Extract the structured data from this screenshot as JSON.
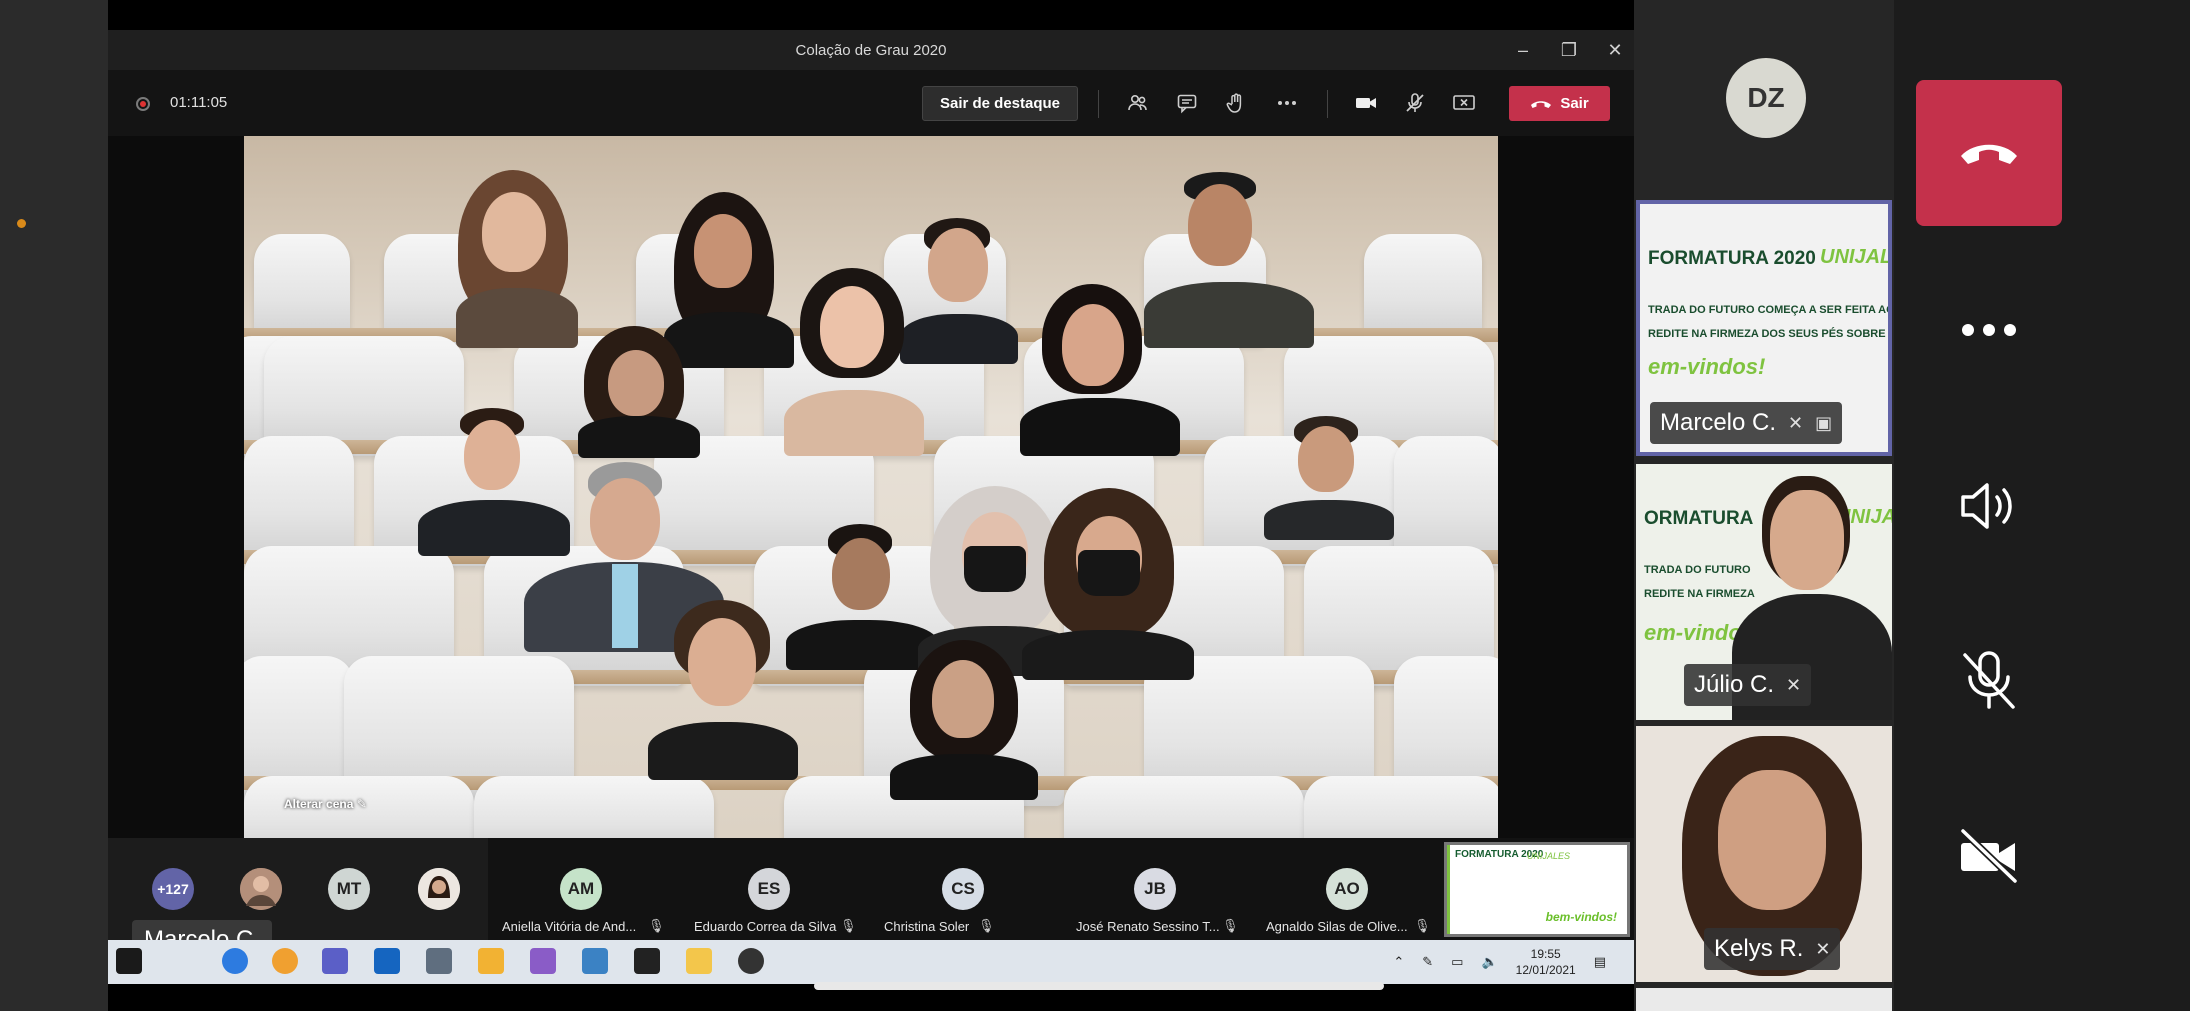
{
  "window": {
    "title": "Colação de Grau 2020",
    "controls": [
      "–",
      "❐",
      "✕"
    ]
  },
  "toolbar": {
    "recording_time": "01:11:05",
    "spotlight_label": "Sair de destaque",
    "leave_label": "Sair"
  },
  "stage": {
    "scene_label": "Alterar cena ✎"
  },
  "strip": {
    "overflow": "+127",
    "avatars": [
      {
        "initials": "MT",
        "color": "#cfd6d3"
      },
      {
        "initials": "AM",
        "color": "#c5e3c9"
      },
      {
        "initials": "ES",
        "color": "#d4d6da"
      },
      {
        "initials": "CS",
        "color": "#d6dde6"
      },
      {
        "initials": "JB",
        "color": "#d9dbe3"
      },
      {
        "initials": "AO",
        "color": "#d5e1d8"
      }
    ],
    "names": [
      "Aniella Vitória de And...",
      "Eduardo Correa da Silva",
      "Christina Soler",
      "José Renato Sessino T...",
      "Agnaldo Silas de Olive..."
    ],
    "mini_slide": {
      "title": "FORMATURA 2020",
      "brand": "UNIJALES",
      "greeting": "bem-vindos!"
    }
  },
  "overlay_name": "Marcelo C.",
  "taskbar": {
    "time": "19:55",
    "date": "12/01/2021"
  },
  "right_panel": {
    "me_initials": "DZ",
    "tiles": [
      {
        "name": "Marcelo C.",
        "slide_title": "FORMATURA 2020",
        "brand": "UNIJALES",
        "line1": "TRADA DO FUTURO COMEÇA A SER FEITA AG",
        "line2": "REDITE NA FIRMEZA DOS SEUS PÉS SOBRE E",
        "greeting": "em-vindos!"
      },
      {
        "name": "Júlio C.",
        "slide_title": "ORMATURA",
        "brand": "UNIJALES",
        "line1": "TRADA DO FUTURO",
        "line2": "REDITE NA FIRMEZA",
        "greeting": "em-vindos"
      },
      {
        "name": "Kelys R."
      }
    ]
  }
}
